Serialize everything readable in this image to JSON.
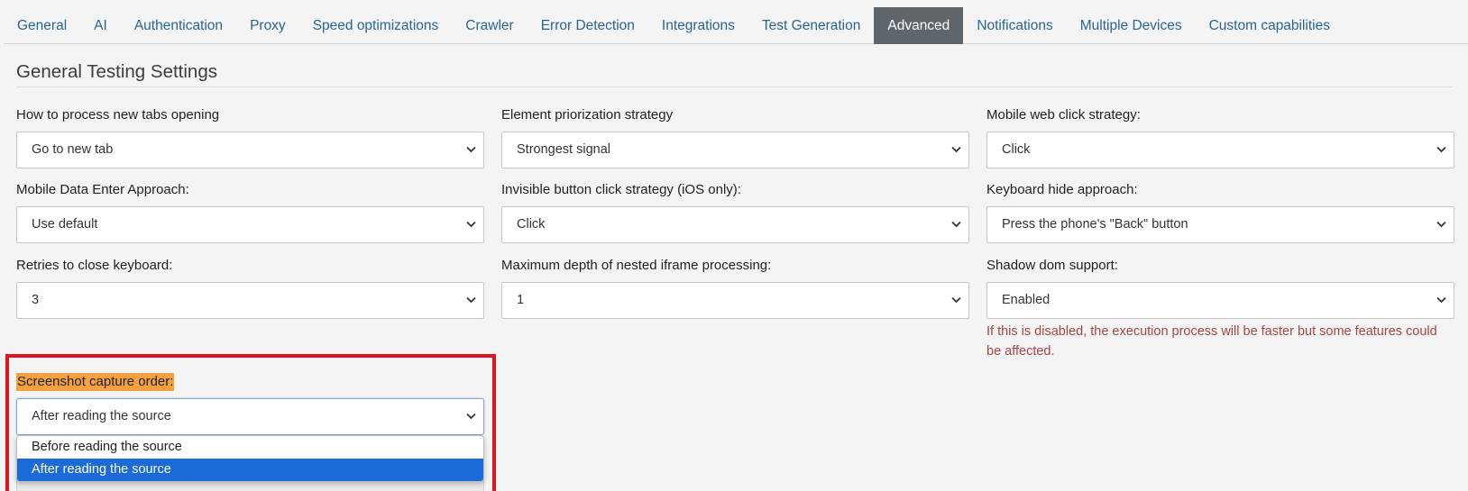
{
  "tabs": [
    {
      "label": "General",
      "active": false
    },
    {
      "label": "AI",
      "active": false
    },
    {
      "label": "Authentication",
      "active": false
    },
    {
      "label": "Proxy",
      "active": false
    },
    {
      "label": "Speed optimizations",
      "active": false
    },
    {
      "label": "Crawler",
      "active": false
    },
    {
      "label": "Error Detection",
      "active": false
    },
    {
      "label": "Integrations",
      "active": false
    },
    {
      "label": "Test Generation",
      "active": false
    },
    {
      "label": "Advanced",
      "active": true
    },
    {
      "label": "Notifications",
      "active": false
    },
    {
      "label": "Multiple Devices",
      "active": false
    },
    {
      "label": "Custom capabilities",
      "active": false
    }
  ],
  "section": {
    "title": "General Testing Settings"
  },
  "fields": {
    "new_tabs": {
      "label": "How to process new tabs opening",
      "value": "Go to new tab"
    },
    "element_prioritization": {
      "label": "Element priorization strategy",
      "value": "Strongest signal"
    },
    "mobile_click": {
      "label": "Mobile web click strategy:",
      "value": "Click"
    },
    "mobile_data_enter": {
      "label": "Mobile Data Enter Approach:",
      "value": "Use default"
    },
    "invisible_button": {
      "label": "Invisible button click strategy (iOS only):",
      "value": "Click"
    },
    "keyboard_hide": {
      "label": "Keyboard hide approach:",
      "value": "Press the phone's \"Back\" button"
    },
    "retries_keyboard": {
      "label": "Retries to close keyboard:",
      "value": "3"
    },
    "iframe_depth": {
      "label": "Maximum depth of nested iframe processing:",
      "value": "1"
    },
    "shadow_dom": {
      "label": "Shadow dom support:",
      "value": "Enabled",
      "help": "If this is disabled, the execution process will be faster but some features could be affected."
    },
    "screenshot_order": {
      "label": "Screenshot capture order:",
      "value": "After reading the source",
      "options": [
        "Before reading the source",
        "After reading the source"
      ],
      "selected_index": 1
    }
  },
  "colors": {
    "tab_text": "#2a6591",
    "tab_active_bg": "#5f666b",
    "help_text": "#a94442",
    "highlight_border": "#e0141e",
    "label_highlight": "#f5a140",
    "option_selected": "#1a6bd8"
  },
  "icons": {
    "select_arrow": "chevron-down-icon"
  }
}
